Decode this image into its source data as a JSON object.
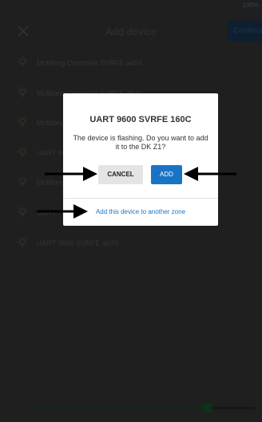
{
  "status": {
    "text": "100%"
  },
  "header": {
    "title": "Add device",
    "action_label": "Continue"
  },
  "devices": [
    {
      "label": "McWong Controller SVRFE a484"
    },
    {
      "label": "McWong Controller SVRFE 252a"
    },
    {
      "label": "McWong Controller SVRFE 1b4c"
    },
    {
      "label": "UART 9600 SVRFE"
    },
    {
      "label": "McWong"
    },
    {
      "label": "UART"
    },
    {
      "label": "UART 9600 SVRFE a970"
    }
  ],
  "dialog": {
    "title": "UART 9600 SVRFE 160C",
    "message": "The device is flashing. Do you want to add it to the DK Z1?",
    "cancel_label": "CANCEL",
    "add_label": "ADD",
    "link_label": "Add this device to another zone"
  },
  "slider": {
    "left_label": "Mesh",
    "value_fraction": 0.78
  },
  "colors": {
    "accent": "#1a74c6",
    "background": "#3a3a3a",
    "arrow": "#000000"
  }
}
